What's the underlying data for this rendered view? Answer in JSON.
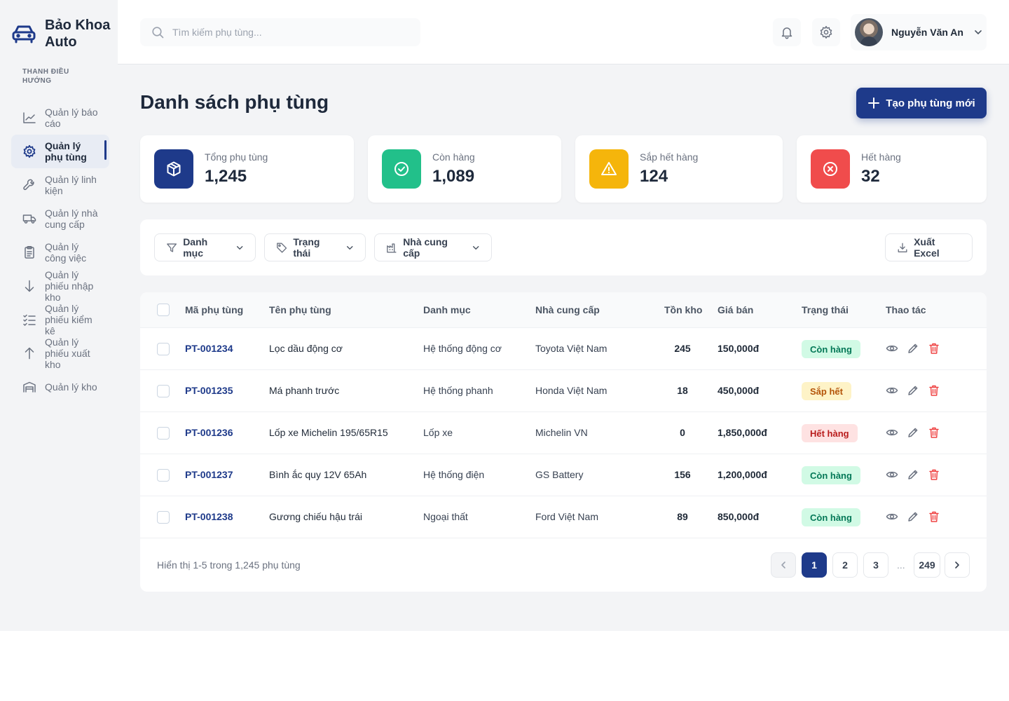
{
  "brand": {
    "name": "Bảo Khoa Auto"
  },
  "sidebar": {
    "title": "THANH ĐIỀU HƯỚNG",
    "items": [
      {
        "label": "Quản lý báo cáo",
        "icon": "chart-line-icon"
      },
      {
        "label": "Quản lý phụ tùng",
        "icon": "gear-icon",
        "active": true
      },
      {
        "label": "Quản lý linh kiện",
        "icon": "wrench-icon"
      },
      {
        "label": "Quản lý nhà cung cấp",
        "icon": "truck-icon"
      },
      {
        "label": "Quản lý công việc",
        "icon": "clipboard-icon"
      },
      {
        "label": "Quản lý phiếu nhập kho",
        "icon": "arrow-down-icon"
      },
      {
        "label": "Quản lý phiếu kiểm kê",
        "icon": "checklist-icon"
      },
      {
        "label": "Quản lý phiếu xuất kho",
        "icon": "arrow-up-icon"
      },
      {
        "label": "Quản lý kho",
        "icon": "warehouse-icon"
      }
    ]
  },
  "header": {
    "search_placeholder": "Tìm kiếm phụ tùng...",
    "user_name": "Nguyễn Văn An"
  },
  "page": {
    "title": "Danh sách phụ tùng",
    "create_label": "Tạo phụ tùng mới"
  },
  "stats": [
    {
      "label": "Tổng phụ tùng",
      "value": "1,245",
      "color": "#1e3a8a",
      "icon": "box-icon"
    },
    {
      "label": "Còn hàng",
      "value": "1,089",
      "color": "#22c08a",
      "icon": "check-circle-icon"
    },
    {
      "label": "Sắp hết hàng",
      "value": "124",
      "color": "#f5b50b",
      "icon": "warning-icon"
    },
    {
      "label": "Hết hàng",
      "value": "32",
      "color": "#f04c4c",
      "icon": "x-circle-icon"
    }
  ],
  "filters": {
    "category": "Danh mục",
    "status": "Trạng thái",
    "supplier": "Nhà cung cấp",
    "export": "Xuất Excel"
  },
  "table": {
    "columns": [
      "Mã phụ tùng",
      "Tên phụ tùng",
      "Danh mục",
      "Nhà cung cấp",
      "Tồn kho",
      "Giá bán",
      "Trạng thái",
      "Thao tác"
    ],
    "rows": [
      {
        "code": "PT-001234",
        "name": "Lọc dầu động cơ",
        "category": "Hệ thống động cơ",
        "supplier": "Toyota Việt Nam",
        "stock": "245",
        "price": "150,000đ",
        "status": "Còn hàng",
        "status_type": "in"
      },
      {
        "code": "PT-001235",
        "name": "Má phanh trước",
        "category": "Hệ thống phanh",
        "supplier": "Honda Việt Nam",
        "stock": "18",
        "price": "450,000đ",
        "status": "Sắp hết",
        "status_type": "low"
      },
      {
        "code": "PT-001236",
        "name": "Lốp xe Michelin 195/65R15",
        "category": "Lốp xe",
        "supplier": "Michelin VN",
        "stock": "0",
        "price": "1,850,000đ",
        "status": "Hết hàng",
        "status_type": "out"
      },
      {
        "code": "PT-001237",
        "name": "Bình ắc quy 12V 65Ah",
        "category": "Hệ thống điện",
        "supplier": "GS Battery",
        "stock": "156",
        "price": "1,200,000đ",
        "status": "Còn hàng",
        "status_type": "in"
      },
      {
        "code": "PT-001238",
        "name": "Gương chiếu hậu trái",
        "category": "Ngoại thất",
        "supplier": "Ford Việt Nam",
        "stock": "89",
        "price": "850,000đ",
        "status": "Còn hàng",
        "status_type": "in"
      }
    ]
  },
  "status_colors": {
    "in": {
      "bg": "#d1fae5",
      "fg": "#047857"
    },
    "low": {
      "bg": "#fef3c7",
      "fg": "#b45309"
    },
    "out": {
      "bg": "#fee2e2",
      "fg": "#b91c1c"
    }
  },
  "pagination": {
    "summary": "Hiển thị 1-5 trong 1,245 phụ tùng",
    "pages": [
      "1",
      "2",
      "3"
    ],
    "ellipsis": "...",
    "last": "249",
    "current": "1"
  }
}
